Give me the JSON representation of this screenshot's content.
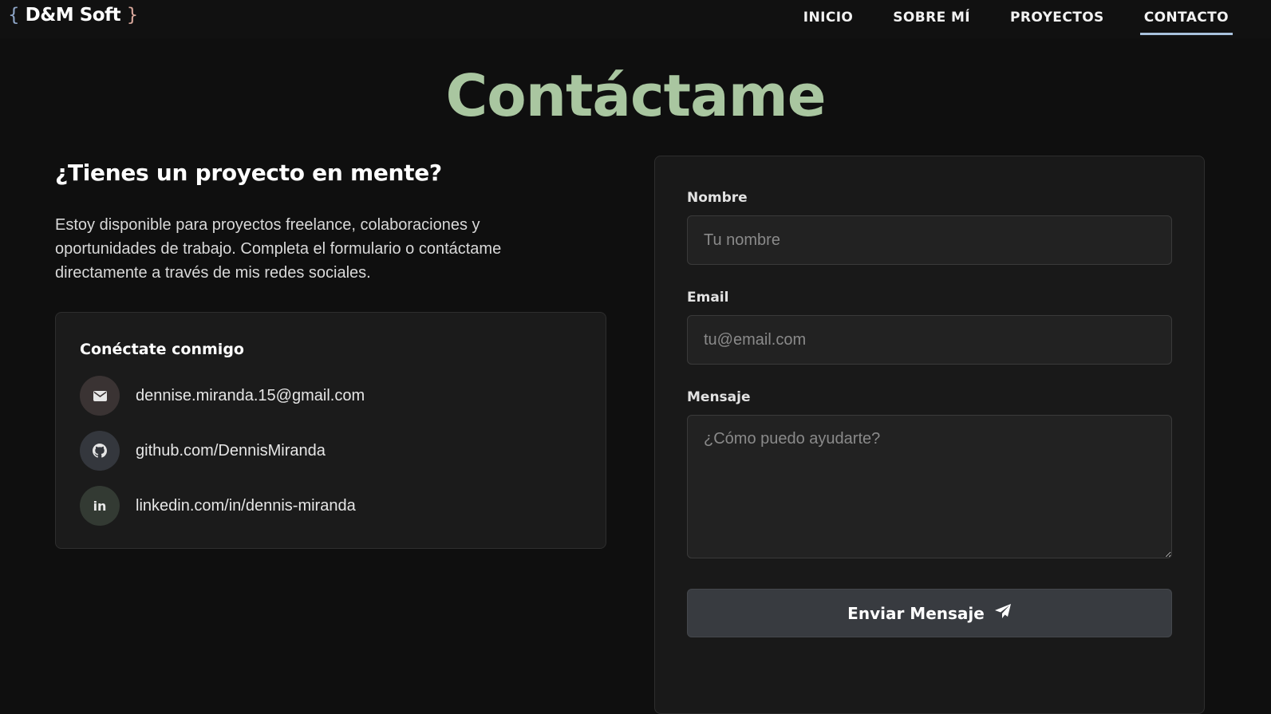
{
  "brand": {
    "brace_open": "{",
    "name": "D&M Soft",
    "brace_close": "}"
  },
  "nav": {
    "items": [
      {
        "label": "INICIO",
        "active": false
      },
      {
        "label": "SOBRE MÍ",
        "active": false
      },
      {
        "label": "PROYECTOS",
        "active": false
      },
      {
        "label": "CONTACTO",
        "active": true
      }
    ]
  },
  "page": {
    "title": "Contáctame"
  },
  "intro": {
    "heading": "¿Tienes un proyecto en mente?",
    "description": "Estoy disponible para proyectos freelance, colaboraciones y oportunidades de trabajo. Completa el formulario o contáctame directamente a través de mis redes sociales."
  },
  "connect": {
    "title": "Conéctate conmigo",
    "items": [
      {
        "icon": "mail-icon",
        "text": "dennise.miranda.15@gmail.com"
      },
      {
        "icon": "github-icon",
        "text": "github.com/DennisMiranda"
      },
      {
        "icon": "linkedin-icon",
        "icon_text": "in",
        "text": "linkedin.com/in/dennis-miranda"
      }
    ]
  },
  "form": {
    "name_label": "Nombre",
    "name_placeholder": "Tu nombre",
    "email_label": "Email",
    "email_placeholder": "tu@email.com",
    "message_label": "Mensaje",
    "message_placeholder": "¿Cómo puedo ayudarte?",
    "submit_label": "Enviar Mensaje",
    "submit_icon": "paper-plane-icon"
  },
  "colors": {
    "background": "#0f0f0f",
    "title_green": "#a9c6a0",
    "nav_active_underline": "#a9c2dd",
    "card_bg": "#1b1b1b",
    "button_bg": "#383b40"
  }
}
